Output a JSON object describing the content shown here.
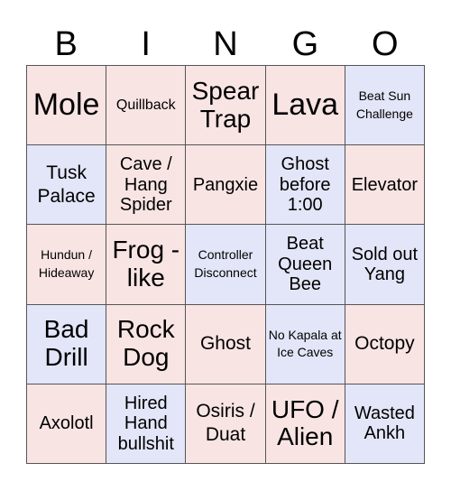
{
  "header": [
    "B",
    "I",
    "N",
    "G",
    "O"
  ],
  "colors": {
    "pink": "#f9e4e4",
    "blue": "#e3e6f8",
    "border": "#555555"
  },
  "cells": [
    {
      "text": "Mole",
      "color": "pink",
      "size": "s1"
    },
    {
      "text": "Quillback",
      "color": "pink",
      "size": "s5"
    },
    {
      "text": "Spear Trap",
      "color": "pink",
      "size": "s2"
    },
    {
      "text": "Lava",
      "color": "pink",
      "size": "s1"
    },
    {
      "text": "Beat Sun Challenge",
      "color": "blue",
      "size": "s6"
    },
    {
      "text": "Tusk Palace",
      "color": "blue",
      "size": "s3"
    },
    {
      "text": "Cave / Hang Spider",
      "color": "pink",
      "size": "s4"
    },
    {
      "text": "Pangxie",
      "color": "pink",
      "size": "s4"
    },
    {
      "text": "Ghost before 1:00",
      "color": "blue",
      "size": "s4"
    },
    {
      "text": "Elevator",
      "color": "pink",
      "size": "s4"
    },
    {
      "text": "Hundun / Hideaway",
      "color": "pink",
      "size": "s6"
    },
    {
      "text": "Frog -like",
      "color": "pink",
      "size": "s2"
    },
    {
      "text": "Controller Disconnect",
      "color": "blue",
      "size": "s6"
    },
    {
      "text": "Beat Queen Bee",
      "color": "blue",
      "size": "s4"
    },
    {
      "text": "Sold out Yang",
      "color": "blue",
      "size": "s4"
    },
    {
      "text": "Bad Drill",
      "color": "blue",
      "size": "s2"
    },
    {
      "text": "Rock Dog",
      "color": "pink",
      "size": "s2"
    },
    {
      "text": "Ghost",
      "color": "pink",
      "size": "s3"
    },
    {
      "text": "No Kapala at Ice Caves",
      "color": "blue",
      "size": "s6"
    },
    {
      "text": "Octopy",
      "color": "pink",
      "size": "s3"
    },
    {
      "text": "Axolotl",
      "color": "pink",
      "size": "s4"
    },
    {
      "text": "Hired Hand bullshit",
      "color": "blue",
      "size": "s4"
    },
    {
      "text": "Osiris / Duat",
      "color": "pink",
      "size": "s3"
    },
    {
      "text": "UFO / Alien",
      "color": "pink",
      "size": "s2"
    },
    {
      "text": "Wasted Ankh",
      "color": "blue",
      "size": "s4"
    }
  ]
}
